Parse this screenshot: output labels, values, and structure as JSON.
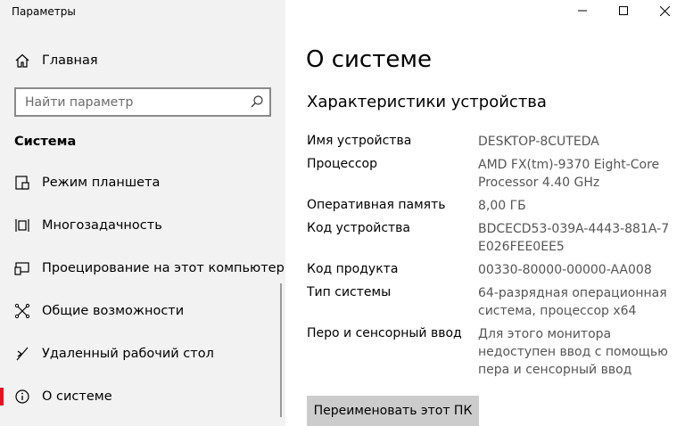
{
  "window": {
    "title": "Параметры"
  },
  "sidebar": {
    "home_label": "Главная",
    "search_placeholder": "Найти параметр",
    "section_title": "Система",
    "items": [
      {
        "label": "Режим планшета",
        "icon": "tablet-mode-icon",
        "active": false
      },
      {
        "label": "Многозадачность",
        "icon": "multitasking-icon",
        "active": false
      },
      {
        "label": "Проецирование на этот компьютер",
        "icon": "projecting-icon",
        "active": false
      },
      {
        "label": "Общие возможности",
        "icon": "shared-experiences-icon",
        "active": false
      },
      {
        "label": "Удаленный рабочий стол",
        "icon": "remote-desktop-icon",
        "active": false
      },
      {
        "label": "О системе",
        "icon": "info-icon",
        "active": true
      }
    ]
  },
  "main": {
    "title": "О системе",
    "subtitle": "Характеристики устройства",
    "specs": [
      {
        "label": "Имя устройства",
        "value": "DESKTOP-8CUTEDA"
      },
      {
        "label": "Процессор",
        "value": "AMD FX(tm)-9370 Eight-Core Processor 4.40 GHz"
      },
      {
        "label": "Оперативная память",
        "value": "8,00 ГБ"
      },
      {
        "label": "Код устройства",
        "value": "BDCECD53-039A-4443-881A-7E026FEE0EE5"
      },
      {
        "label": "Код продукта",
        "value": "00330-80000-00000-AA008"
      },
      {
        "label": "Тип системы",
        "value": "64-разрядная операционная система, процессор x64"
      },
      {
        "label": "Перо и сенсорный ввод",
        "value": "Для этого монитора недоступен ввод с помощью пера и сенсорный ввод"
      }
    ],
    "rename_button": "Переименовать этот ПК"
  },
  "colors": {
    "accent": "#e81123",
    "sidebar_bg": "#f2f2f2",
    "button_bg": "#cccccc"
  }
}
